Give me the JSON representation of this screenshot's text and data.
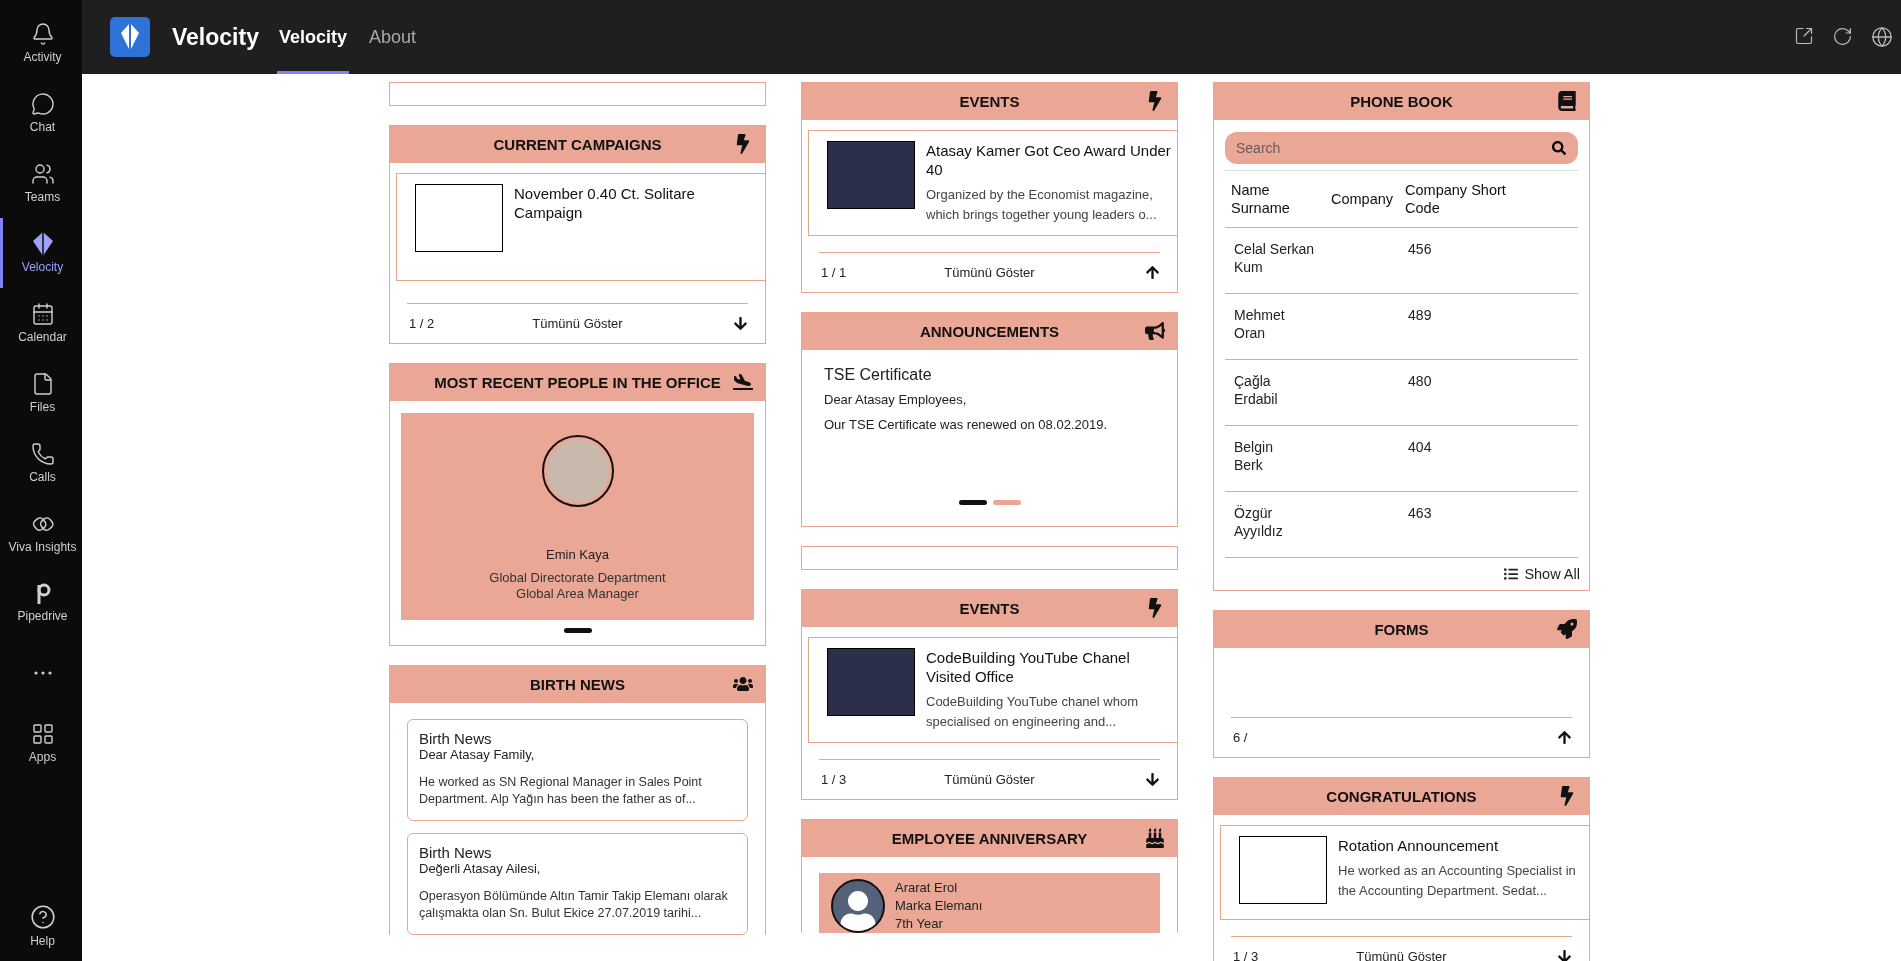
{
  "sidebar": {
    "items": [
      {
        "label": "Activity",
        "selected": false
      },
      {
        "label": "Chat",
        "selected": false
      },
      {
        "label": "Teams",
        "selected": false
      },
      {
        "label": "Velocity",
        "selected": true
      },
      {
        "label": "Calendar",
        "selected": false
      },
      {
        "label": "Files",
        "selected": false
      },
      {
        "label": "Calls",
        "selected": false
      },
      {
        "label": "Viva Insights",
        "selected": false
      },
      {
        "label": "Pipedrive",
        "selected": false
      }
    ],
    "apps": {
      "label": "Apps"
    },
    "help": {
      "label": "Help"
    }
  },
  "app_bar": {
    "title": "Velocity",
    "tabs": [
      {
        "label": "Velocity",
        "selected": true
      },
      {
        "label": "About",
        "selected": false
      }
    ]
  },
  "columns": [
    {
      "cards": [
        {
          "kind": "empty"
        },
        {
          "kind": "carousel",
          "title": "CURRENT CAMPAIGNS",
          "item": {
            "photo": false,
            "title": "November 0.40 Ct. Solitare Campaign"
          },
          "footer": {
            "pager": "1 / 2",
            "link": "Tümünü Göster",
            "arrow_up": false
          }
        },
        {
          "kind": "people",
          "title": "MOST RECENT PEOPLE IN THE OFFICE",
          "person": {
            "name": "Emin Kaya",
            "department": "Global Directorate Department",
            "role": "Global Area Manager"
          },
          "dots": [
            {
              "selected": true
            }
          ]
        },
        {
          "kind": "birth_news",
          "title": "BIRTH NEWS",
          "items": [
            {
              "title": "Birth News",
              "greeting": "Dear Atasay Family,",
              "body": "He worked as SN Regional Manager in Sales Point Department. Alp Yağın has been the father as of..."
            },
            {
              "title": "Birth News",
              "greeting": "Değerli Atasay Ailesi,",
              "body": "Operasyon Bölümünde Altın Tamir Takip Elemanı olarak çalışmakta olan Sn. Bulut Ekice 27.07.2019 tarihi..."
            }
          ]
        }
      ]
    },
    {
      "cards": [
        {
          "kind": "carousel",
          "title": "EVENTS",
          "item": {
            "photo": true,
            "title": "Atasay Kamer Got Ceo Award Under 40",
            "description": "Organized by the Economist magazine, which brings together young leaders o..."
          },
          "footer": {
            "pager": "1 / 1",
            "link": "Tümünü Göster",
            "arrow_up": true
          }
        },
        {
          "kind": "announcement",
          "title": "ANNOUNCEMENTS",
          "item": {
            "title": "TSE Certificate",
            "greeting": "Dear Atasay Employees,",
            "body": "Our TSE Certificate was renewed on 08.02.2019."
          },
          "dots": [
            {
              "selected": true
            },
            {
              "selected": false
            }
          ]
        },
        {
          "kind": "empty"
        },
        {
          "kind": "carousel",
          "title": "EVENTS",
          "item": {
            "photo": true,
            "title": "CodeBuilding YouTube Chanel Visited Office",
            "description": "CodeBuilding YouTube chanel whom specialised on engineering and..."
          },
          "footer": {
            "pager": "1 / 3",
            "link": "Tümünü Göster",
            "arrow_up": false
          }
        },
        {
          "kind": "anniversary",
          "title": "EMPLOYEE ANNIVERSARY",
          "person": {
            "name": "Ararat Erol",
            "role": "Marka Elemanı",
            "years": "7th Year"
          }
        }
      ]
    },
    {
      "cards": [
        {
          "kind": "phonebook",
          "title": "PHONE BOOK",
          "search": {
            "placeholder": "Search"
          },
          "columns": [
            "Name Surname",
            "Company",
            "Company Short Code"
          ],
          "rows": [
            {
              "first": "Celal Serkan",
              "last": "Kum",
              "code": "456"
            },
            {
              "first": "Mehmet",
              "last": "Oran",
              "code": "489"
            },
            {
              "first": "Çağla",
              "last": "Erdabil",
              "code": "480"
            },
            {
              "first": "Belgin",
              "last": "Berk",
              "code": "404"
            },
            {
              "first": "Özgür",
              "last": "Ayyıldız",
              "code": "463"
            }
          ],
          "show_all": "Show All"
        },
        {
          "kind": "forms",
          "title": "FORMS",
          "footer": {
            "pager": "6 /",
            "arrow_up": true
          }
        },
        {
          "kind": "carousel",
          "title": "CONGRATULATIONS",
          "item": {
            "photo": false,
            "title": "Rotation Announcement",
            "description": "He worked as an Accounting Specialist in the Accounting Department. Sedat..."
          },
          "footer": {
            "pager": "1 / 3",
            "link": "Tümünü Göster",
            "arrow_up": false
          }
        }
      ]
    }
  ]
}
